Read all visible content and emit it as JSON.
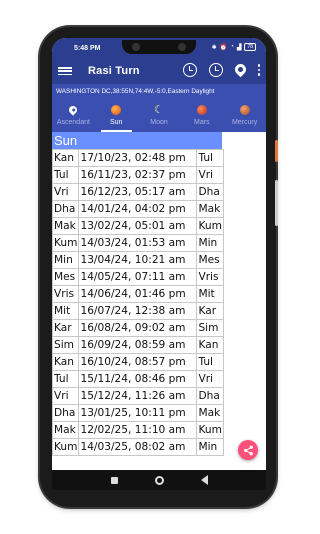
{
  "status": {
    "time": "5:48 PM",
    "battery": "78"
  },
  "toolbar": {
    "title": "Rasi Turn"
  },
  "location": "WASHINGTON DC,38:55N,74:4W,-5:0,Eastern Daylight",
  "tabs": [
    {
      "label": "Ascendant",
      "icon": "location-pin-icon"
    },
    {
      "label": "Sun",
      "icon": "sun-planet-icon",
      "active": true
    },
    {
      "label": "Moon",
      "icon": "moon-icon"
    },
    {
      "label": "Mars",
      "icon": "mars-planet-icon"
    },
    {
      "label": "Mercury",
      "icon": "mercury-planet-icon"
    }
  ],
  "table": {
    "title": "Sun",
    "rows": [
      [
        "Kan",
        "17/10/23, 02:48 pm",
        "Tul"
      ],
      [
        "Tul",
        "16/11/23, 02:37 pm",
        "Vri"
      ],
      [
        "Vri",
        "16/12/23, 05:17 am",
        "Dha"
      ],
      [
        "Dha",
        "14/01/24, 04:02 pm",
        "Mak"
      ],
      [
        "Mak",
        "13/02/24, 05:01 am",
        "Kum"
      ],
      [
        "Kum",
        "14/03/24, 01:53 am",
        "Min"
      ],
      [
        "Min",
        "13/04/24, 10:21 am",
        "Mes"
      ],
      [
        "Mes",
        "14/05/24, 07:11 am",
        "Vris"
      ],
      [
        "Vris",
        "14/06/24, 01:46 pm",
        "Mit"
      ],
      [
        "Mit",
        "16/07/24, 12:38 am",
        "Kar"
      ],
      [
        "Kar",
        "16/08/24, 09:02 am",
        "Sim"
      ],
      [
        "Sim",
        "16/09/24, 08:59 am",
        "Kan"
      ],
      [
        "Kan",
        "16/10/24, 08:57 pm",
        "Tul"
      ],
      [
        "Tul",
        "15/11/24, 08:46 pm",
        "Vri"
      ],
      [
        "Vri",
        "15/12/24, 11:26 am",
        "Dha"
      ],
      [
        "Dha",
        "13/01/25, 10:11 pm",
        "Mak"
      ],
      [
        "Mak",
        "12/02/25, 11:10 am",
        "Kum"
      ],
      [
        "Kum",
        "14/03/25, 08:02 am",
        "Min"
      ]
    ]
  },
  "colors": {
    "appbar": "#2c3e8f",
    "tabbar": "#3b4fb0",
    "table_header": "#6a8fff",
    "fab": "#ff4f7b"
  }
}
